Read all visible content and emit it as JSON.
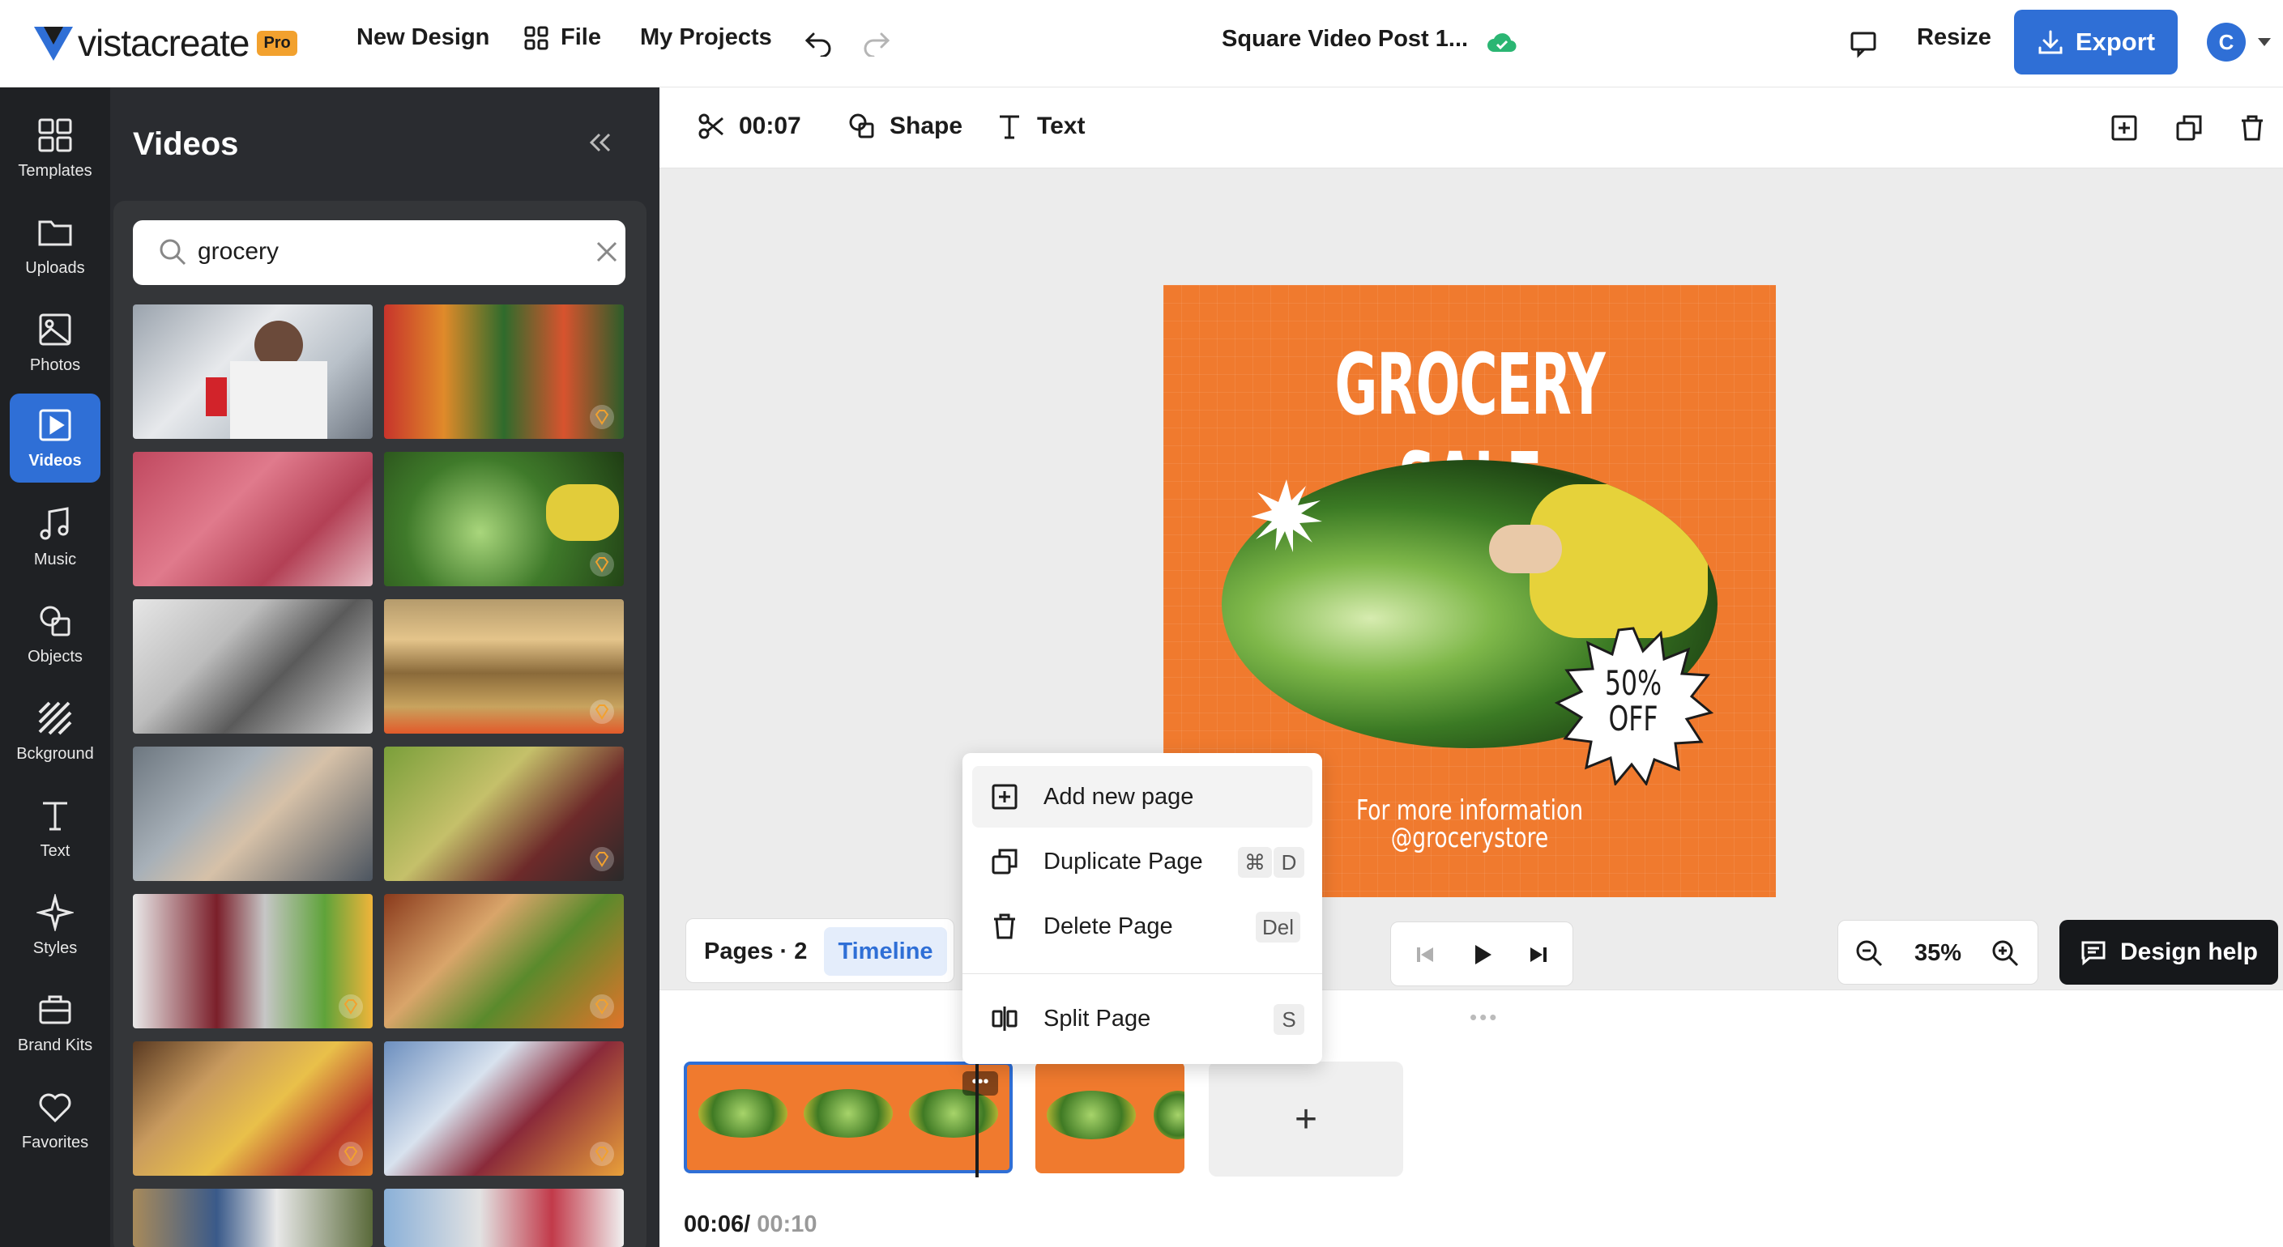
{
  "app": {
    "logo_text": "vistacreate",
    "badge": "Pro",
    "menu": [
      "New Design",
      "File",
      "My Projects"
    ],
    "doc_title": "Square Video Post 1...",
    "resize": "Resize",
    "export": "Export",
    "avatar_initial": "C"
  },
  "rail": [
    {
      "label": "Templates",
      "icon": "templates-icon"
    },
    {
      "label": "Uploads",
      "icon": "folder-icon"
    },
    {
      "label": "Photos",
      "icon": "image-icon"
    },
    {
      "label": "Videos",
      "icon": "video-icon"
    },
    {
      "label": "Music",
      "icon": "music-icon"
    },
    {
      "label": "Objects",
      "icon": "objects-icon"
    },
    {
      "label": "Bckground",
      "icon": "background-icon"
    },
    {
      "label": "Text",
      "icon": "text-icon"
    },
    {
      "label": "Styles",
      "icon": "sparkle-icon"
    },
    {
      "label": "Brand Kits",
      "icon": "briefcase-icon"
    },
    {
      "label": "Favorites",
      "icon": "heart-icon"
    }
  ],
  "panel": {
    "title": "Videos",
    "search_value": "grocery"
  },
  "toolbar": {
    "trim_time": "00:07",
    "shape": "Shape",
    "text": "Text"
  },
  "artboard": {
    "title": "GROCERY SALE",
    "discount_line1": "50%",
    "discount_line2": "OFF",
    "info_line1": "For more information",
    "info_line2": "@grocerystore"
  },
  "context_menu": {
    "add_page": "Add new page",
    "duplicate": "Duplicate Page",
    "duplicate_key1": "⌘",
    "duplicate_key2": "D",
    "delete": "Delete Page",
    "delete_key": "Del",
    "split": "Split Page",
    "split_key": "S"
  },
  "bottom": {
    "pages_label": "Pages · 2",
    "timeline_tab": "Timeline",
    "zoom": "35%",
    "design_help": "Design help",
    "current_time": "00:06/",
    "total_time": "00:10",
    "add_page_symbol": "+"
  },
  "colors": {
    "accent": "#2f6fd6",
    "artboard": "#f07a2e",
    "rail_bg": "#1f2124",
    "panel_bg": "#2a2c30"
  }
}
